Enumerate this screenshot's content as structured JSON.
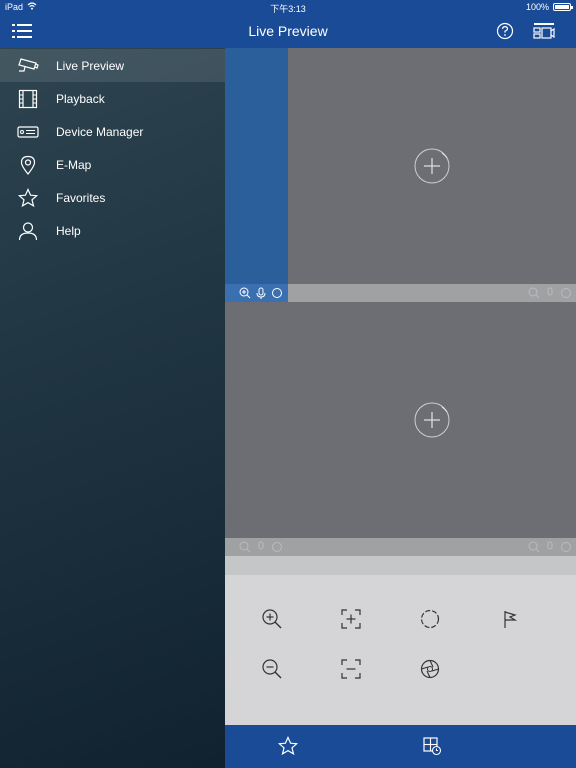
{
  "status": {
    "device": "iPad",
    "time": "下午3:13",
    "battery": "100%",
    "battery_level": 1.0
  },
  "nav": {
    "title": "Live Preview"
  },
  "sidebar": {
    "items": [
      {
        "label": "Live Preview",
        "icon": "camera-icon",
        "active": true
      },
      {
        "label": "Playback",
        "icon": "film-icon",
        "active": false
      },
      {
        "label": "Device Manager",
        "icon": "device-icon",
        "active": false
      },
      {
        "label": "E-Map",
        "icon": "map-pin-icon",
        "active": false
      },
      {
        "label": "Favorites",
        "icon": "star-icon",
        "active": false
      },
      {
        "label": "Help",
        "icon": "user-icon",
        "active": false
      }
    ]
  },
  "colors": {
    "accent": "#1a4b97",
    "selected": "#2b5f9c",
    "pane": "#6c6e73",
    "panel": "#d5d5d7"
  }
}
